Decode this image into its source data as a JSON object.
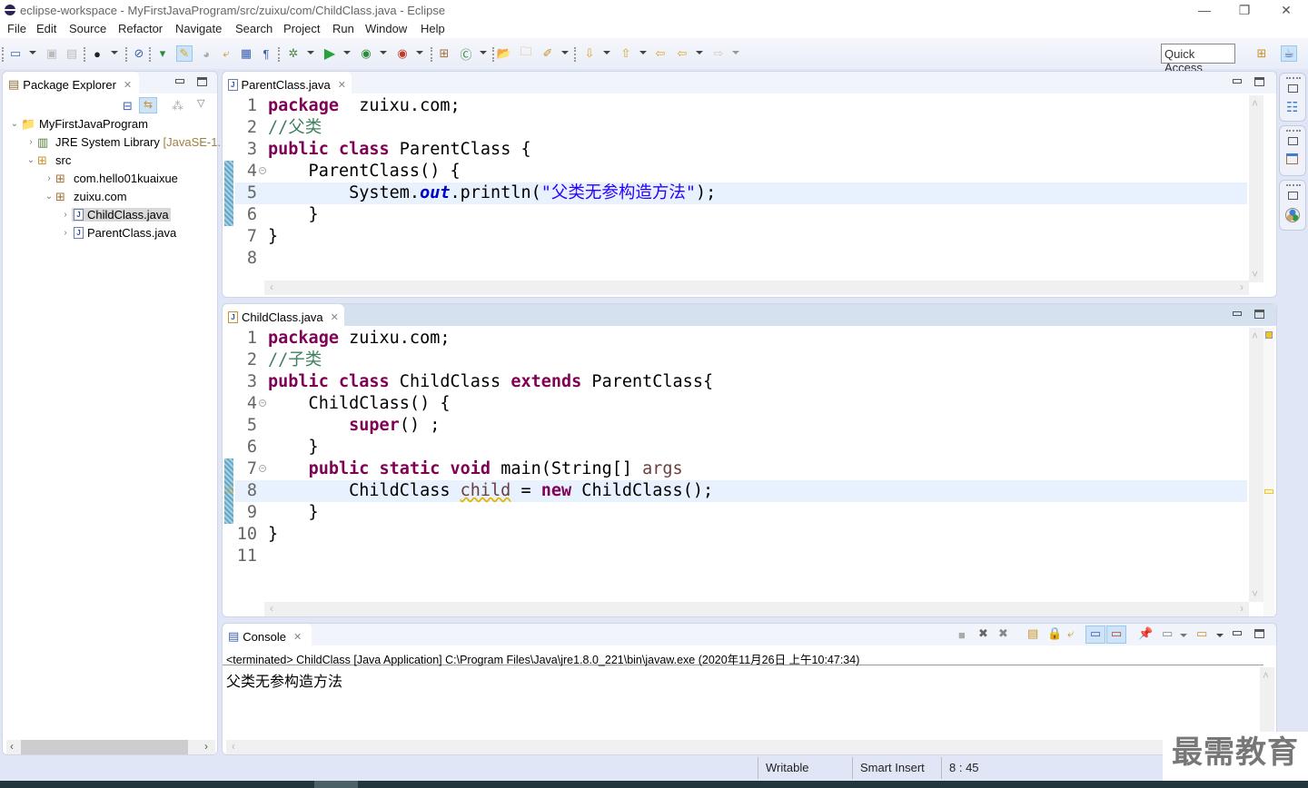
{
  "window": {
    "title": "eclipse-workspace - MyFirstJavaProgram/src/zuixu/com/ChildClass.java - Eclipse",
    "controls": {
      "minimize": "—",
      "restore": "❐",
      "close": "✕"
    }
  },
  "menu": [
    "File",
    "Edit",
    "Source",
    "Refactor",
    "Navigate",
    "Search",
    "Project",
    "Run",
    "Window",
    "Help"
  ],
  "toolbar": {
    "quick_access": "Quick Access",
    "icons": [
      "new-wizard-icon",
      "save-icon",
      "save-all-icon",
      "profile-icon",
      "skip-breakpoints-icon",
      "open-type-icon",
      "mark-occurrences-icon",
      "toggle-block-icon",
      "word-wrap-icon",
      "show-whitespace-icon",
      "pilcrow-icon",
      "debug-icon",
      "run-icon",
      "coverage-icon",
      "external-tools-icon",
      "new-package-icon",
      "new-class-icon",
      "open-project-icon",
      "open-folder-icon",
      "search-icon",
      "next-annotation-icon",
      "prev-annotation-icon",
      "last-edit-icon",
      "back-icon",
      "forward-icon",
      "open-perspective-icon",
      "java-perspective-icon"
    ]
  },
  "package_explorer": {
    "title": "Package Explorer",
    "tree": [
      {
        "label": "MyFirstJavaProgram",
        "expanded": true,
        "level": 0
      },
      {
        "label": "JRE System Library",
        "suffix": "[JavaSE-1.",
        "expanded": false,
        "level": 1
      },
      {
        "label": "src",
        "expanded": true,
        "level": 1
      },
      {
        "label": "com.hello01kuaixue",
        "expanded": false,
        "level": 2
      },
      {
        "label": "zuixu.com",
        "expanded": true,
        "level": 2
      },
      {
        "label": "ChildClass.java",
        "expanded": false,
        "level": 3,
        "selected": true
      },
      {
        "label": "ParentClass.java",
        "expanded": false,
        "level": 3
      }
    ]
  },
  "editor_parent": {
    "tab": "ParentClass.java",
    "lines": [
      {
        "n": "1",
        "parts": [
          [
            "kw",
            "package"
          ],
          [
            "",
            "  zuixu.com;"
          ]
        ]
      },
      {
        "n": "2",
        "parts": [
          [
            "cm",
            "//父类"
          ]
        ]
      },
      {
        "n": "3",
        "parts": [
          [
            "kw",
            "public"
          ],
          [
            "",
            " "
          ],
          [
            "kw",
            "class"
          ],
          [
            "",
            " ParentClass {"
          ]
        ]
      },
      {
        "n": "4",
        "parts": [
          [
            "",
            "    ParentClass() {"
          ]
        ]
      },
      {
        "n": "5",
        "parts": [
          [
            "",
            "        System."
          ],
          [
            "fld",
            "out"
          ],
          [
            "",
            ".println("
          ],
          [
            "st",
            "\"父类无参构造方法\""
          ],
          [
            "",
            ");"
          ]
        ]
      },
      {
        "n": "6",
        "parts": [
          [
            "",
            "    }"
          ]
        ]
      },
      {
        "n": "7",
        "parts": [
          [
            "",
            "}"
          ]
        ]
      },
      {
        "n": "8",
        "parts": []
      }
    ],
    "highlight_line": 5
  },
  "editor_child": {
    "tab": "ChildClass.java",
    "lines": [
      {
        "n": "1",
        "parts": [
          [
            "kw",
            "package"
          ],
          [
            "",
            " zuixu.com;"
          ]
        ]
      },
      {
        "n": "2",
        "parts": [
          [
            "cm",
            "//子类"
          ]
        ]
      },
      {
        "n": "3",
        "parts": [
          [
            "kw",
            "public"
          ],
          [
            "",
            " "
          ],
          [
            "kw",
            "class"
          ],
          [
            "",
            " ChildClass "
          ],
          [
            "kw",
            "extends"
          ],
          [
            "",
            " ParentClass{"
          ]
        ]
      },
      {
        "n": "4",
        "parts": [
          [
            "",
            "    ChildClass() {"
          ]
        ]
      },
      {
        "n": "5",
        "parts": [
          [
            "",
            "        "
          ],
          [
            "kw",
            "super"
          ],
          [
            "",
            "() ;"
          ]
        ]
      },
      {
        "n": "6",
        "parts": [
          [
            "",
            "    }"
          ]
        ]
      },
      {
        "n": "7",
        "parts": [
          [
            "",
            "    "
          ],
          [
            "kw",
            "public"
          ],
          [
            "",
            " "
          ],
          [
            "kw",
            "static"
          ],
          [
            "",
            " "
          ],
          [
            "kw",
            "void"
          ],
          [
            "",
            " main(String[] "
          ],
          [
            "var",
            "args"
          ],
          [
            ") {"
          ]
        ]
      },
      {
        "n": "8",
        "parts": [
          [
            "",
            "        ChildClass "
          ],
          [
            "var warnul",
            "child"
          ],
          [
            "",
            " = "
          ],
          [
            "kw",
            "new"
          ],
          [
            "",
            " ChildClass();"
          ]
        ]
      },
      {
        "n": "9",
        "parts": [
          [
            "",
            "    }"
          ]
        ]
      },
      {
        "n": "10",
        "parts": [
          [
            "",
            "}"
          ]
        ]
      },
      {
        "n": "11",
        "parts": []
      }
    ],
    "highlight_line": 8
  },
  "console": {
    "tab": "Console",
    "header": "<terminated> ChildClass [Java Application] C:\\Program Files\\Java\\jre1.8.0_221\\bin\\javaw.exe (2020年11月26日 上午10:47:34)",
    "output": "父类无参构造方法"
  },
  "status_bar": {
    "mode": "Writable",
    "insert": "Smart Insert",
    "position": "8 : 45"
  },
  "watermark": "最需教育"
}
